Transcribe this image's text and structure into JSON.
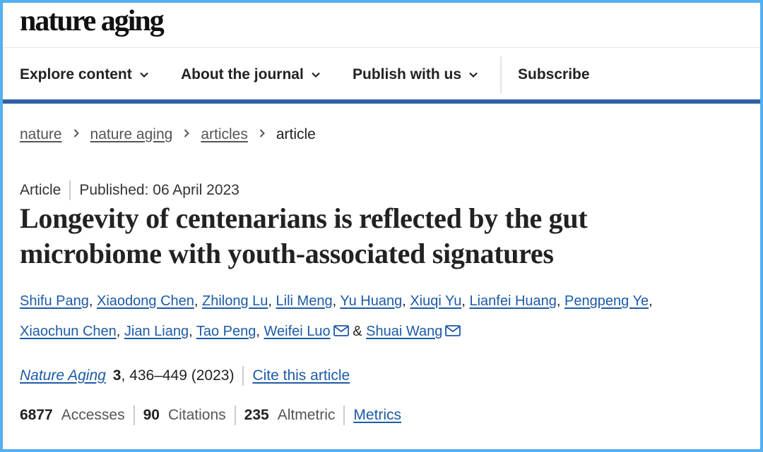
{
  "header": {
    "logo": "nature aging"
  },
  "nav": {
    "items": [
      {
        "label": "Explore content",
        "dropdown": true
      },
      {
        "label": "About the journal",
        "dropdown": true
      },
      {
        "label": "Publish with us",
        "dropdown": true
      }
    ],
    "subscribe": "Subscribe"
  },
  "breadcrumb": {
    "items": [
      "nature",
      "nature aging",
      "articles"
    ],
    "current": "article"
  },
  "article": {
    "type": "Article",
    "published": "Published: 06 April 2023",
    "title": "Longevity of centenarians is reflected by the gut microbiome with youth-associated signatures",
    "authors": [
      "Shifu Pang",
      "Xiaodong Chen",
      "Zhilong Lu",
      "Lili Meng",
      "Yu Huang",
      "Xiuqi Yu",
      "Lianfei Huang",
      "Pengpeng Ye",
      "Xiaochun Chen",
      "Jian Liang",
      "Tao Peng",
      "Weifei Luo",
      "Shuai Wang"
    ],
    "comma": ",",
    "ampersand": "&",
    "journal": "Nature Aging",
    "volume": "3",
    "pages": ", 436–449 (2023)",
    "cite": "Cite this article"
  },
  "metrics": {
    "accesses_value": "6877",
    "accesses_label": "Accesses",
    "citations_value": "90",
    "citations_label": "Citations",
    "altmetric_value": "235",
    "altmetric_label": "Altmetric",
    "link": "Metrics"
  },
  "colors": {
    "link": "#1d5aa6",
    "nav_border": "#3160a8",
    "frame": "#54b0f0"
  },
  "icons": [
    "chevron-down-icon",
    "chevron-right-icon",
    "mail-icon"
  ]
}
